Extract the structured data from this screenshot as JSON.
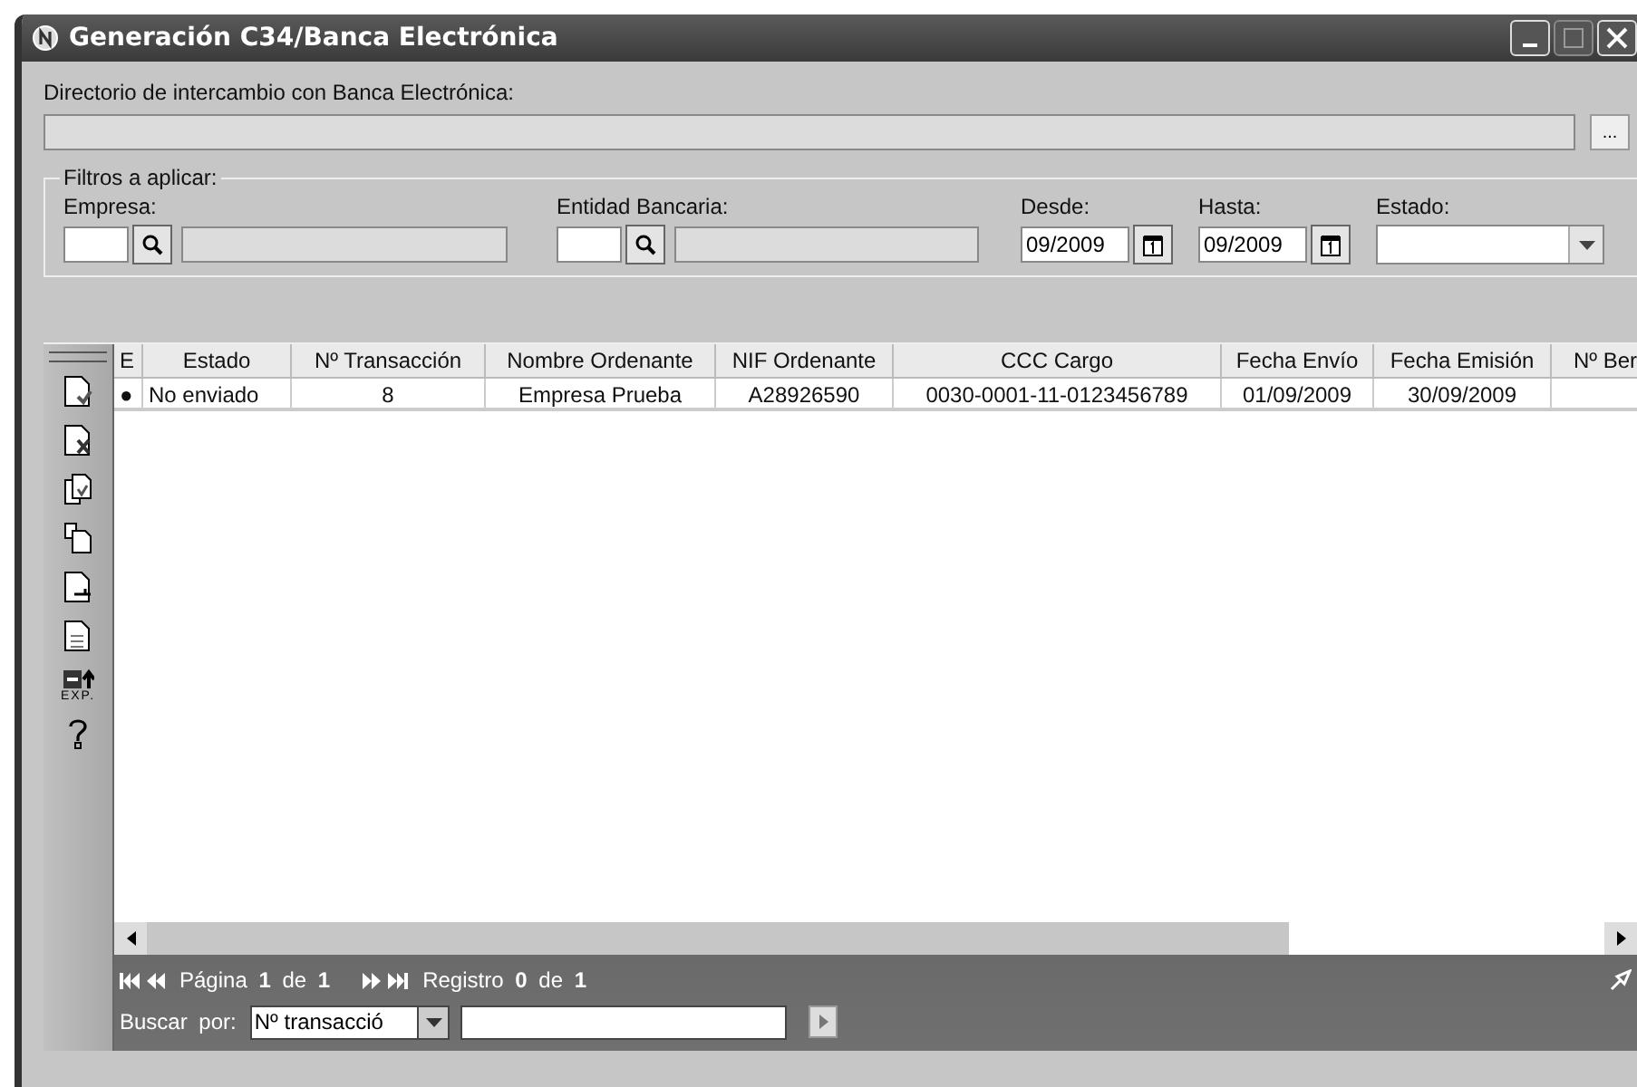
{
  "window": {
    "title": "Generación C34/Banca Electrónica"
  },
  "directory": {
    "label": "Directorio de intercambio con Banca Electrónica:",
    "browse_button": "..."
  },
  "filters": {
    "legend": "Filtros a aplicar:",
    "empresa": {
      "label": "Empresa:"
    },
    "entidad": {
      "label": "Entidad Bancaria:"
    },
    "desde": {
      "label": "Desde:",
      "value": "09/2009"
    },
    "hasta": {
      "label": "Hasta:",
      "value": "09/2009"
    },
    "estado": {
      "label": "Estado:"
    }
  },
  "toolbar": [
    {
      "kind": "new"
    },
    {
      "kind": "delete"
    },
    {
      "kind": "copy"
    },
    {
      "kind": "duplicate"
    },
    {
      "kind": "import"
    },
    {
      "kind": "report"
    },
    {
      "kind": "export",
      "label": "EXP."
    },
    {
      "kind": "help"
    }
  ],
  "table": {
    "columns": [
      "E",
      "Estado",
      "Nº Transacción",
      "Nombre Ordenante",
      "NIF Ordenante",
      "CCC Cargo",
      "Fecha Envío",
      "Fecha Emisión",
      "Nº Ber"
    ],
    "rows": [
      {
        "cells": [
          "●",
          "No enviado",
          "8",
          "Empresa Prueba",
          "A28926590",
          "0030-0001-11-0123456789",
          "01/09/2009",
          "30/09/2009",
          ""
        ]
      }
    ]
  },
  "pager": {
    "page": "Página **1** de **1**",
    "record": "Registro **0** de **1**",
    "search_label": "Buscar por:",
    "search_field": "Nº transacció"
  }
}
